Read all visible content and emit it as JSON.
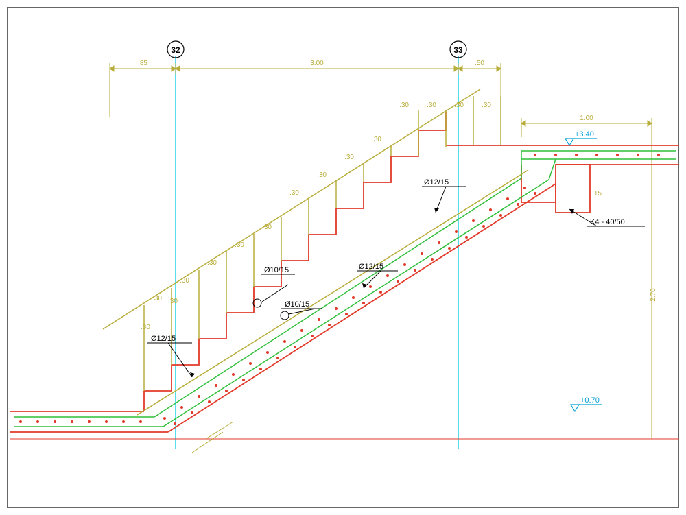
{
  "gridlines": {
    "g32": "32",
    "g33": "33"
  },
  "rebar_callouts": {
    "top_main": "Ø12/15",
    "bottom_main": "Ø12/15",
    "stirrup_upper": "Ø10/15",
    "stirrup_lower": "Ø10/15",
    "landing_main": "Ø12/15"
  },
  "beam_callout": "K4 - 40/50",
  "elevations": {
    "top_landing": "+3.40",
    "bottom_landing": "+0.70"
  },
  "dimensions": {
    "left_ext": ".85",
    "span": "3.00",
    "right_ext": ".50",
    "landing_overhang": "1.00",
    "tread": ".30",
    "riser": ".30",
    "slab_t": ".15",
    "total_rise": "2.70"
  },
  "colors": {
    "concrete": "#e23a2a",
    "rebar": "#2fbf3a",
    "dim": "#b8ad3a",
    "grid": "#1fd3e6",
    "elev": "#00a0d8"
  }
}
